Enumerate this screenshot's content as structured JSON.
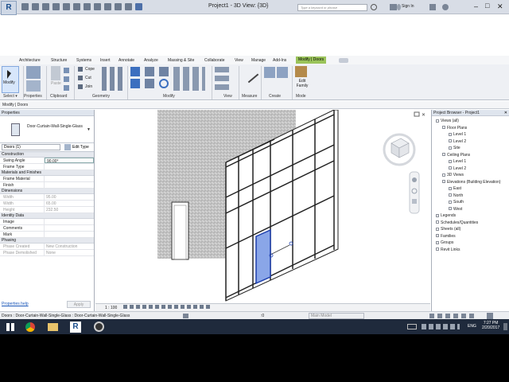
{
  "app": {
    "logo": "R",
    "title": "Project1 - 3D View: {3D}",
    "search_placeholder": "Type a keyword or phrase",
    "sign_in": "Sign In"
  },
  "tabs": [
    {
      "label": "Architecture"
    },
    {
      "label": "Structure"
    },
    {
      "label": "Systems"
    },
    {
      "label": "Insert"
    },
    {
      "label": "Annotate"
    },
    {
      "label": "Analyze"
    },
    {
      "label": "Massing & Site"
    },
    {
      "label": "Collaborate"
    },
    {
      "label": "View"
    },
    {
      "label": "Manage"
    },
    {
      "label": "Add-Ins"
    },
    {
      "label": "Modify | Doors"
    }
  ],
  "ribbon": {
    "modify": "Modify",
    "paste": "Paste",
    "cope": "Cope",
    "cut": "Cut",
    "join": "Join",
    "edit_family": "Edit Family",
    "groups": [
      "Select ▾",
      "Properties",
      "Clipboard",
      "Geometry",
      "Modify",
      "View",
      "Measure",
      "Create",
      "Mode"
    ]
  },
  "option_bar": "Modify | Doors",
  "properties": {
    "header": "Properties",
    "type_name": "Door-Curtain-Wall-Single-Glass",
    "selector": "Doors (1)",
    "edit_type": "Edit Type",
    "sections": {
      "construction": "Construction",
      "materials": "Materials and Finishes",
      "dimensions": "Dimensions",
      "identity": "Identity Data",
      "phasing": "Phasing"
    },
    "rows": {
      "swing_angle": {
        "k": "Swing Angle",
        "v": "90.00°"
      },
      "frame_type": {
        "k": "Frame Type",
        "v": ""
      },
      "frame_material": {
        "k": "Frame Material",
        "v": ""
      },
      "finish": {
        "k": "Finish",
        "v": ""
      },
      "width": {
        "k": "Width",
        "v": "95.00"
      },
      "width2": {
        "k": "Width",
        "v": "65.00"
      },
      "height": {
        "k": "Height",
        "v": "232.50"
      },
      "image": {
        "k": "Image",
        "v": ""
      },
      "comments": {
        "k": "Comments",
        "v": ""
      },
      "mark": {
        "k": "Mark",
        "v": ""
      },
      "phase_created": {
        "k": "Phase Created",
        "v": "New Construction"
      },
      "phase_demolished": {
        "k": "Phase Demolished",
        "v": "None"
      }
    },
    "help": "Properties help",
    "apply": "Apply"
  },
  "view_control": {
    "scale": "1 : 100"
  },
  "browser": {
    "header": "Project Browser - Project1",
    "items": [
      {
        "label": "Views (all)",
        "ind": 0
      },
      {
        "label": "Floor Plans",
        "ind": 1
      },
      {
        "label": "Level 1",
        "ind": 2
      },
      {
        "label": "Level 2",
        "ind": 2
      },
      {
        "label": "Site",
        "ind": 2
      },
      {
        "label": "Ceiling Plans",
        "ind": 1
      },
      {
        "label": "Level 1",
        "ind": 2
      },
      {
        "label": "Level 2",
        "ind": 2
      },
      {
        "label": "3D Views",
        "ind": 1
      },
      {
        "label": "Elevations (Building Elevation)",
        "ind": 1
      },
      {
        "label": "East",
        "ind": 2
      },
      {
        "label": "North",
        "ind": 2
      },
      {
        "label": "South",
        "ind": 2
      },
      {
        "label": "West",
        "ind": 2
      },
      {
        "label": "Legends",
        "ind": 0
      },
      {
        "label": "Schedules/Quantities",
        "ind": 0
      },
      {
        "label": "Sheets (all)",
        "ind": 0
      },
      {
        "label": "Families",
        "ind": 0
      },
      {
        "label": "Groups",
        "ind": 0
      },
      {
        "label": "Revit Links",
        "ind": 0
      }
    ]
  },
  "status": {
    "text": "Doors : Door-Curtain-Wall-Single-Glass : Door-Curtain-Wall-Single-Glass",
    "model": "Main Model",
    "zero": ":0"
  },
  "taskbar": {
    "lang": "ENG",
    "time": "7:27 PM",
    "date": "2/20/2017"
  }
}
